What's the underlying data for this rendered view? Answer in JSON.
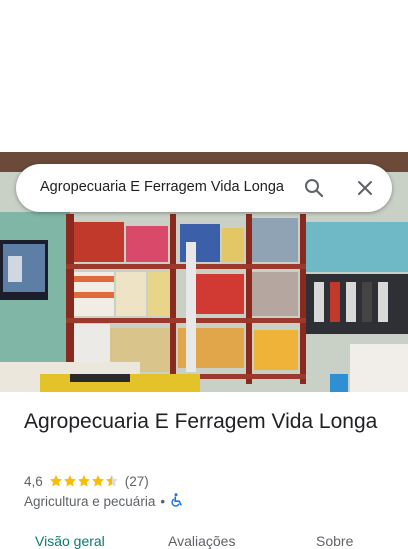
{
  "search": {
    "query": "Agropecuaria E Ferragem Vida Longa"
  },
  "place": {
    "name": "Agropecuaria E Ferragem Vida Longa",
    "rating": "4,6",
    "stars_filled": 4.5,
    "review_count": "(27)",
    "category": "Agricultura e pecuária",
    "separator": "•"
  },
  "tabs": [
    {
      "label": "Visão geral"
    },
    {
      "label": "Avaliações"
    },
    {
      "label": "Sobre"
    }
  ],
  "icons": {
    "search": "search-icon",
    "close": "close-icon",
    "accessibility": "wheelchair-icon",
    "star": "star-icon"
  },
  "colors": {
    "star": "#fbbc04",
    "active_tab": "#0b7a6d",
    "accessibility": "#1a73e8"
  }
}
